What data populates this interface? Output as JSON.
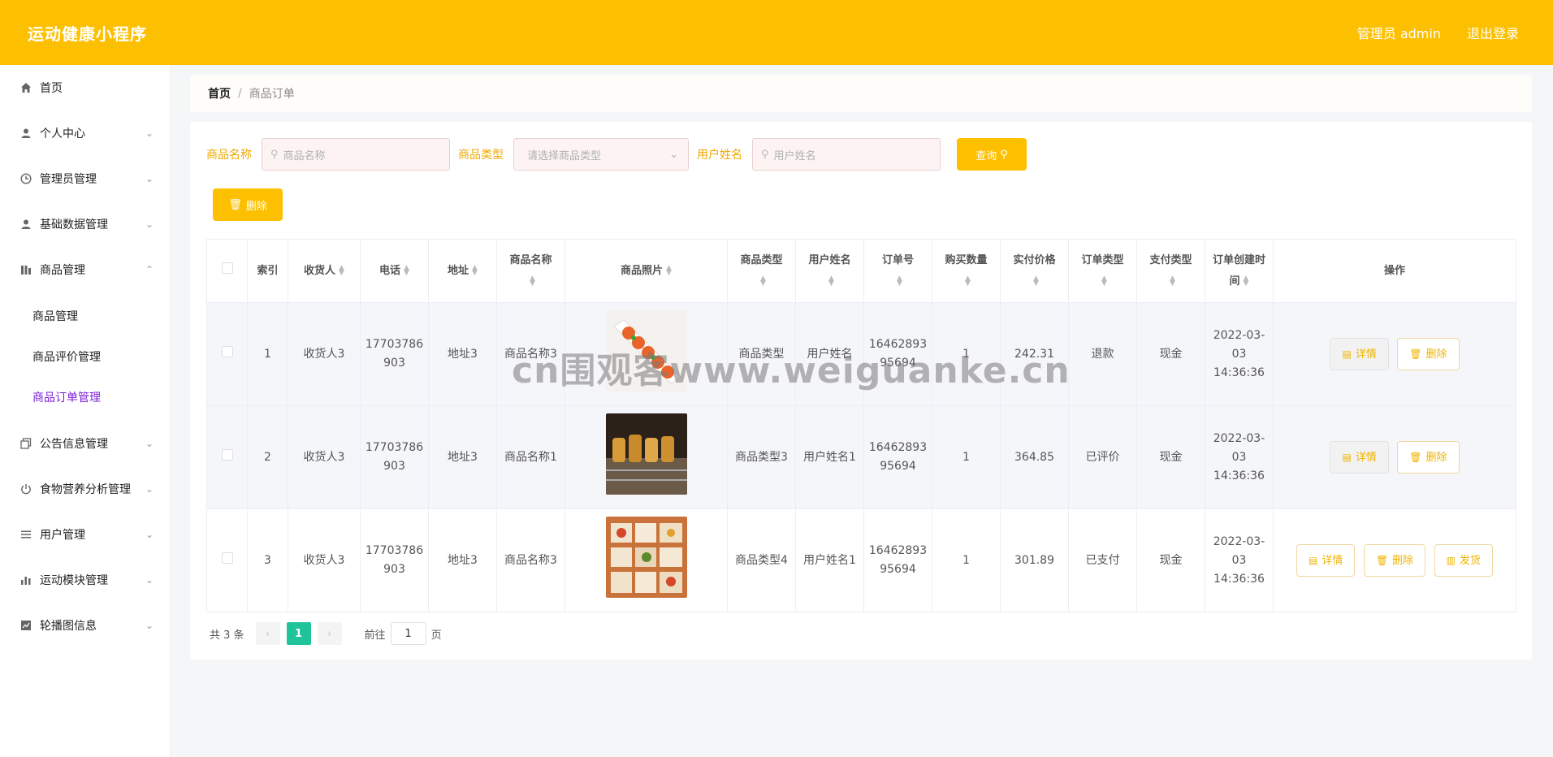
{
  "header": {
    "title": "运动健康小程序",
    "admin_label": "管理员 admin",
    "logout_label": "退出登录"
  },
  "sidebar": {
    "items": [
      {
        "label": "首页",
        "icon": "home-icon"
      },
      {
        "label": "个人中心",
        "icon": "user-icon"
      },
      {
        "label": "管理员管理",
        "icon": "clock-icon"
      },
      {
        "label": "基础数据管理",
        "icon": "user-icon"
      },
      {
        "label": "商品管理",
        "icon": "chart-icon"
      },
      {
        "label": "公告信息管理",
        "icon": "copy-icon"
      },
      {
        "label": "食物营养分析管理",
        "icon": "power-icon"
      },
      {
        "label": "用户管理",
        "icon": "list-icon"
      },
      {
        "label": "运动模块管理",
        "icon": "bar-chart-icon"
      },
      {
        "label": "轮播图信息",
        "icon": "trend-icon"
      }
    ],
    "submenu": [
      "商品管理",
      "商品评价管理",
      "商品订单管理"
    ]
  },
  "breadcrumb": {
    "home": "首页",
    "current": "商品订单"
  },
  "filters": {
    "name_label": "商品名称",
    "name_placeholder": "商品名称",
    "type_label": "商品类型",
    "type_placeholder": "请选择商品类型",
    "user_label": "用户姓名",
    "user_placeholder": "用户姓名",
    "query_label": "查询",
    "delete_label": "删除"
  },
  "table": {
    "headers": [
      "索引",
      "收货人",
      "电话",
      "地址",
      "商品名称",
      "商品照片",
      "商品类型",
      "用户姓名",
      "订单号",
      "购买数量",
      "实付价格",
      "订单类型",
      "支付类型",
      "订单创建时间",
      "操作"
    ],
    "rows": [
      {
        "index": "1",
        "receiver": "收货人3",
        "phone": "17703786903",
        "address": "地址3",
        "product": "商品名称3",
        "ptype": "商品类型",
        "user": "用户姓名",
        "order_no": "1646289395694",
        "qty": "1",
        "price": "242.31",
        "otype": "退款",
        "pay": "现金",
        "time": "2022-03-03 14:36:36"
      },
      {
        "index": "2",
        "receiver": "收货人3",
        "phone": "17703786903",
        "address": "地址3",
        "product": "商品名称1",
        "ptype": "商品类型3",
        "user": "用户姓名1",
        "order_no": "1646289395694",
        "qty": "1",
        "price": "364.85",
        "otype": "已评价",
        "pay": "现金",
        "time": "2022-03-03 14:36:36"
      },
      {
        "index": "3",
        "receiver": "收货人3",
        "phone": "17703786903",
        "address": "地址3",
        "product": "商品名称3",
        "ptype": "商品类型4",
        "user": "用户姓名1",
        "order_no": "1646289395694",
        "qty": "1",
        "price": "301.89",
        "otype": "已支付",
        "pay": "现金",
        "time": "2022-03-03 14:36:36"
      }
    ],
    "ops": {
      "detail": "详情",
      "delete": "删除",
      "ship": "发货"
    }
  },
  "pager": {
    "total": "共 3 条",
    "current": "1",
    "goto": "前往",
    "page_value": "1",
    "page_unit": "页"
  },
  "watermark": "cn围观客www.weiguanke.cn",
  "colors": {
    "accent": "#fdc000",
    "active_menu": "#7b1fd8",
    "pager_current": "#1fc49a"
  }
}
